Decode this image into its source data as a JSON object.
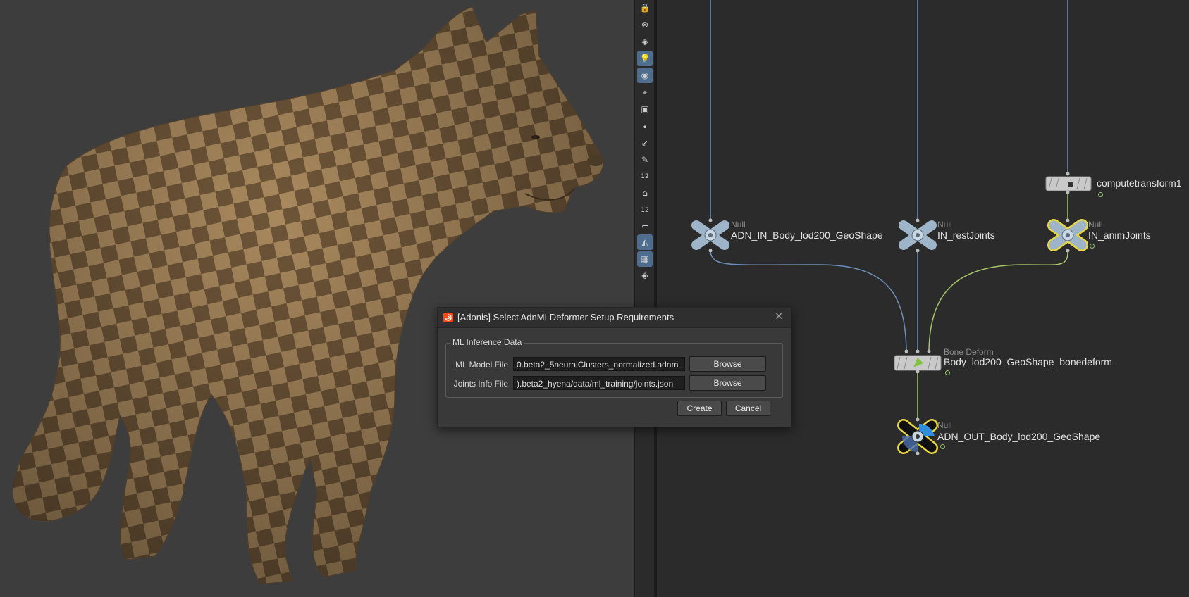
{
  "dialog": {
    "title": "[Adonis] Select AdnMLDeformer Setup Requirements",
    "group_title": "ML Inference Data",
    "model_file": {
      "label": "ML Model File",
      "value": "0.beta2_5neuralClusters_normalized.adnm",
      "browse_label": "Browse"
    },
    "joints_file": {
      "label": "Joints Info File",
      "value": ").beta2_hyena/data/ml_training/joints.json",
      "browse_label": "Browse"
    },
    "create_label": "Create",
    "cancel_label": "Cancel"
  },
  "toolbar": {
    "items": [
      {
        "icon": "lock-icon",
        "active": false
      },
      {
        "icon": "snap-icon",
        "active": false
      },
      {
        "icon": "handle-icon",
        "active": false
      },
      {
        "icon": "light-icon",
        "active": true
      },
      {
        "icon": "shading-icon",
        "active": true
      },
      {
        "icon": "camera-icon",
        "active": false
      },
      {
        "icon": "display-options-icon",
        "active": false
      },
      {
        "icon": "point-icon",
        "active": false
      },
      {
        "icon": "normal-icon",
        "active": false
      },
      {
        "icon": "brush-icon",
        "active": false
      },
      {
        "icon": "point-numbers-icon",
        "active": false,
        "glyph": "12"
      },
      {
        "icon": "paint-icon",
        "active": false
      },
      {
        "icon": "prim-numbers-icon",
        "active": false,
        "glyph": "12"
      },
      {
        "icon": "guide-icon",
        "active": false
      },
      {
        "icon": "wireframe-icon",
        "active": true
      },
      {
        "icon": "texture-icon",
        "active": true
      },
      {
        "icon": "ghost-icon",
        "active": false
      }
    ]
  },
  "network": {
    "nodes": {
      "computetransform": {
        "type": "",
        "name": "computetransform1"
      },
      "adn_in_body": {
        "type": "Null",
        "name": "ADN_IN_Body_lod200_GeoShape"
      },
      "in_rest_joints": {
        "type": "Null",
        "name": "IN_restJoints"
      },
      "in_anim_joints": {
        "type": "Null",
        "name": "IN_animJoints"
      },
      "bone_deform": {
        "type": "Bone Deform",
        "name": "Body_lod200_GeoShape_bonedeform"
      },
      "adn_out_body": {
        "type": "Null",
        "name": "ADN_OUT_Body_lod200_GeoShape"
      }
    },
    "colors": {
      "wire_blue": "#6f8fb8",
      "wire_green": "#a9c46a",
      "highlight_yellow": "#e8d640",
      "null_node": "#9eb4c8",
      "display_flag": "#2f8fdc"
    }
  }
}
